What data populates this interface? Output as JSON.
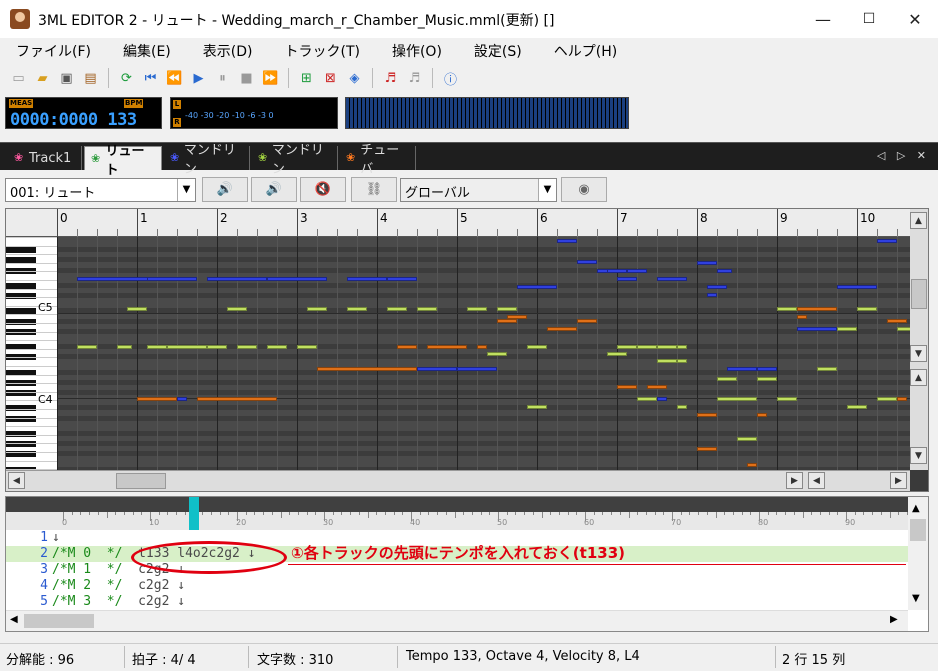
{
  "window": {
    "title": "3ML EDITOR 2 - リュート - Wedding_march_r_Chamber_Music.mml(更新) []",
    "minimize": "—",
    "maximize": "☐",
    "close": "✕"
  },
  "menu": [
    "ファイル(F)",
    "編集(E)",
    "表示(D)",
    "トラック(T)",
    "操作(O)",
    "設定(S)",
    "ヘルプ(H)"
  ],
  "toolbar_icons": [
    "new-file-icon",
    "open-folder-icon",
    "save-icon",
    "save-all-icon",
    "reload-icon",
    "go-start-icon",
    "rewind-icon",
    "play-icon",
    "pause-icon",
    "stop-icon",
    "fast-forward-icon",
    "add-track-icon",
    "delete-track-icon",
    "track-settings-icon",
    "mml-export-icon",
    "mml-import-icon",
    "info-icon"
  ],
  "counter": {
    "meas_label": "MEAS",
    "bpm_label": "BPM",
    "value": "0000:0000 133"
  },
  "level_meter": {
    "left_label": "L",
    "right_label": "R",
    "scale": "-40   -30   -20 -10 -6 -3  0"
  },
  "tabs": [
    {
      "label": "Track1",
      "color": "#ff5aa0",
      "active": false
    },
    {
      "label": "リュート",
      "color": "#2a9a3a",
      "active": true
    },
    {
      "label": "マンドリン",
      "color": "#4a5aff",
      "active": false
    },
    {
      "label": "マンドリン",
      "color": "#a0d040",
      "active": false
    },
    {
      "label": "チューバ",
      "color": "#ff7a20",
      "active": false
    }
  ],
  "tab_nav": "◁ ▷ ✕",
  "track_bar": {
    "track_select": "001: リュート",
    "scope_select": "グローバル"
  },
  "piano_roll": {
    "measures": [
      "0",
      "1",
      "2",
      "3",
      "4",
      "5",
      "6",
      "7",
      "8",
      "9",
      "10"
    ],
    "key_labels": [
      "C5",
      "C4"
    ],
    "note_colors": {
      "blue": "#3040e0",
      "lime": "#c0e060",
      "orange": "#e07018"
    }
  },
  "editor": {
    "ruler_ticks": [
      "0",
      "10",
      "20",
      "30",
      "40",
      "50",
      "60",
      "70",
      "80",
      "90",
      "100"
    ],
    "lines": [
      {
        "num": "1",
        "comment": "",
        "notes": "↓"
      },
      {
        "num": "2",
        "comment": "/*M 0  */",
        "notes": "  t133 l4o2c2g2 ↓"
      },
      {
        "num": "3",
        "comment": "/*M 1  */",
        "notes": "  c2g2 ↓"
      },
      {
        "num": "4",
        "comment": "/*M 2  */",
        "notes": "  c2g2 ↓"
      },
      {
        "num": "5",
        "comment": "/*M 3  */",
        "notes": "  c2g2 ↓"
      }
    ]
  },
  "annotation": "①各トラックの先頭にテンポを入れておく(t133)",
  "status": {
    "resolution": "分解能 : 96",
    "beat": "拍子 :  4/  4",
    "chars": "文字数 : 310",
    "info": "Tempo 133, Octave 4, Velocity  8, L4",
    "position": "2 行 15 列"
  }
}
